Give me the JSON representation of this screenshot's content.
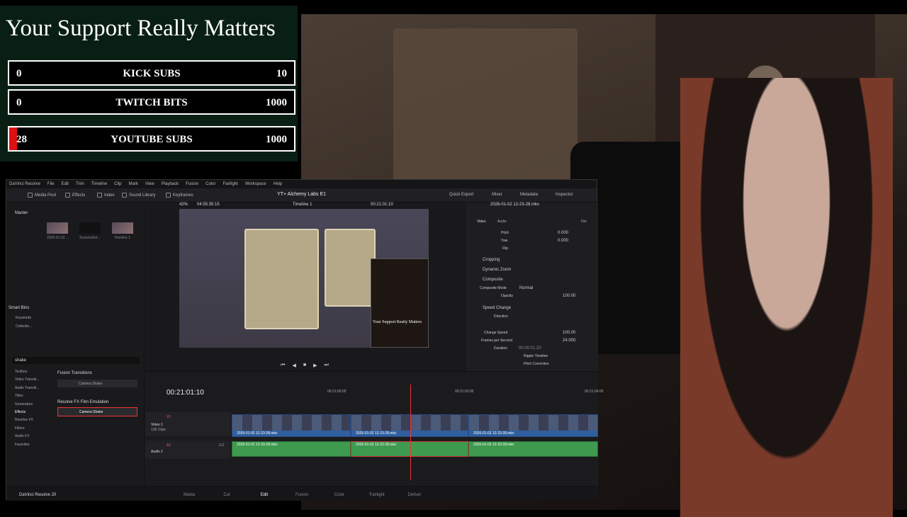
{
  "goals": {
    "title": "Your Support Really Matters",
    "items": [
      {
        "current": "0",
        "label": "KICK SUBS",
        "max": "10",
        "progress": 0
      },
      {
        "current": "0",
        "label": "TWITCH BITS",
        "max": "1000",
        "progress": 0
      },
      {
        "current": "28",
        "label": "YOUTUBE SUBS",
        "max": "1000",
        "progress": 0.028
      }
    ]
  },
  "resolve": {
    "menu": [
      "DaVinci Resolve",
      "File",
      "Edit",
      "Trim",
      "Timeline",
      "Clip",
      "Mark",
      "View",
      "Playback",
      "Fusion",
      "Color",
      "Fairlight",
      "Workspace",
      "Help"
    ],
    "toolbar_left": [
      "Media Pool",
      "Effects",
      "Index",
      "Sound Library",
      "Keyframes"
    ],
    "project_title": "YT+ Alchemy Labs E1",
    "toolbar_right": [
      "Quick Export",
      "Mixer",
      "Metadata",
      "Inspector"
    ],
    "zoom": "42%",
    "src_timecode": "04:55:35:15",
    "timeline_name": "Timeline 1",
    "rec_timecode": "00:21:01:10",
    "clip_name": "2026-01-02 12-23-28.mkv",
    "bins": {
      "master": "Master",
      "smart_bins": "Smart Bins",
      "keywords": "Keywords",
      "collections": "Collectio..."
    },
    "media": [
      "2026-01-02 ...",
      "Screenshot...",
      "Timeline 1"
    ],
    "search": "shake",
    "toolbox": [
      "Toolbox",
      "Video Transiti...",
      "Audio Transiti...",
      "Titles",
      "Generators",
      "Effects",
      "Resolve FX",
      "Filters",
      "Audio FX",
      "Favorites"
    ],
    "fx_sections": [
      "Fusion Transitions",
      "Resolve FX Film Emulation"
    ],
    "fx_items": [
      "Camera Shake",
      "Camera Shake"
    ],
    "inspector": {
      "tabs": [
        "Video",
        "Audio",
        "File"
      ],
      "pitch_label": "Pitch",
      "pitch": "0.000",
      "yaw_label": "Yaw",
      "yaw": "0.000",
      "flip_label": "Flip",
      "sections": [
        "Cropping",
        "Dynamic Zoom",
        "Composite",
        "Speed Change"
      ],
      "composite_mode_label": "Composite Mode",
      "composite_mode": "Normal",
      "opacity_label": "Opacity",
      "opacity": "100.00",
      "direction_label": "Direction",
      "change_speed_label": "Change Speed",
      "change_speed": "100.00",
      "fps_label": "Frames per Second",
      "fps": "24.000",
      "duration_label": "Duration",
      "duration": "00:00:01:20",
      "ripple": "Ripple Timeline",
      "pitch_correction": "Pitch Correction"
    },
    "timeline": {
      "timecode": "00:21:01:10",
      "ruler": [
        "00:21:00:00",
        "00:21:02:00",
        "00:21:04:00"
      ],
      "v1": "V1",
      "v1_name": "Video 1",
      "v1_clips": "130 Clips",
      "a1": "A1",
      "a1_name": "Audio 1",
      "a1_level": "2.0",
      "clip": "2026-01-02 12-23-28.mkv"
    },
    "pages": [
      "Media",
      "Cut",
      "Edit",
      "Fusion",
      "Color",
      "Fairlight",
      "Deliver"
    ],
    "active_page": "Edit",
    "app_name": "DaVinci Resolve 20"
  }
}
